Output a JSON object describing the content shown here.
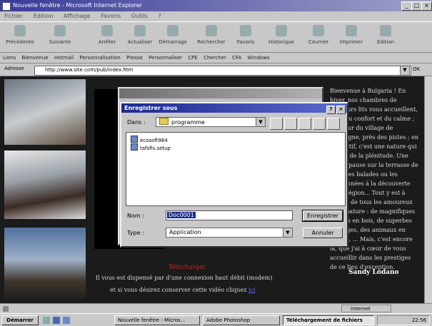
{
  "browser": {
    "title": "Nouvelle fenêtre - Microsoft Internet Explorer",
    "menu": [
      "Fichier",
      "Edition",
      "Affichage",
      "Favoris",
      "Outils",
      "?"
    ],
    "toolbar": [
      "Précédente",
      "Suivante",
      "Arrêter",
      "Actualiser",
      "Démarrage",
      "Rechercher",
      "Favoris",
      "Historique",
      "Courrier",
      "Imprimer",
      "Edition"
    ],
    "links_label": "Liens",
    "links": [
      "Bienvenue",
      "Hotmail",
      "Personnalisation",
      "Presse",
      "Personnaliser",
      "CPE",
      "Chercher",
      "CFA",
      "Windows"
    ],
    "address_label": "Adresse",
    "address_value": "http://www.site.com/pub/index.htm",
    "go_label": "OK",
    "status_zone": "Internet"
  },
  "page": {
    "right_text": "Bienvenue à Bulgaria ! En hiver, nos chambres de plusieurs lits vous accueillent, avec du confort et du calme ; au cœur du village de montagne, près des pistes ; en été, actif, c'est une nature qui donne de la plénitude. Une petite pause sur la terrasse de gîte, des balades ou les randonnées à la découverte de la région... Tout y est à portée de tous les amoureux de la nature : de magnifiques chalets en bois, de superbes paysages, des animaux en liberté, ... Mais, c'est encore là, que j'ai à cœur de vous accueillir dans les prestiges de ce lieu d'exception.",
    "signature": "Sandy Lodano",
    "red_label": "Télécharger",
    "bottom_line1": "Il vous est dispensé par d'une connexion haut débit (modem)",
    "bottom_line2": "et si vous désirez conserver cette vidéo cliquez",
    "bottom_link": "ici"
  },
  "save_dialog": {
    "title": "Enregistrer sous",
    "look_in_label": "Dans :",
    "look_in_value": "programme",
    "files": [
      "ecosoft984",
      "tafsfis.setup"
    ],
    "name_label": "Nom :",
    "name_value": "Doc0001",
    "type_label": "Type :",
    "type_value": "Application",
    "save_button": "Enregistrer",
    "cancel_button": "Annuler"
  },
  "taskbar": {
    "start_label": "Démarrer",
    "tasks": [
      "Nouvelle fenêtre - Micros...",
      "Adobe Photoshop",
      "Téléchargement de fichiers"
    ],
    "clock": "22:56"
  }
}
